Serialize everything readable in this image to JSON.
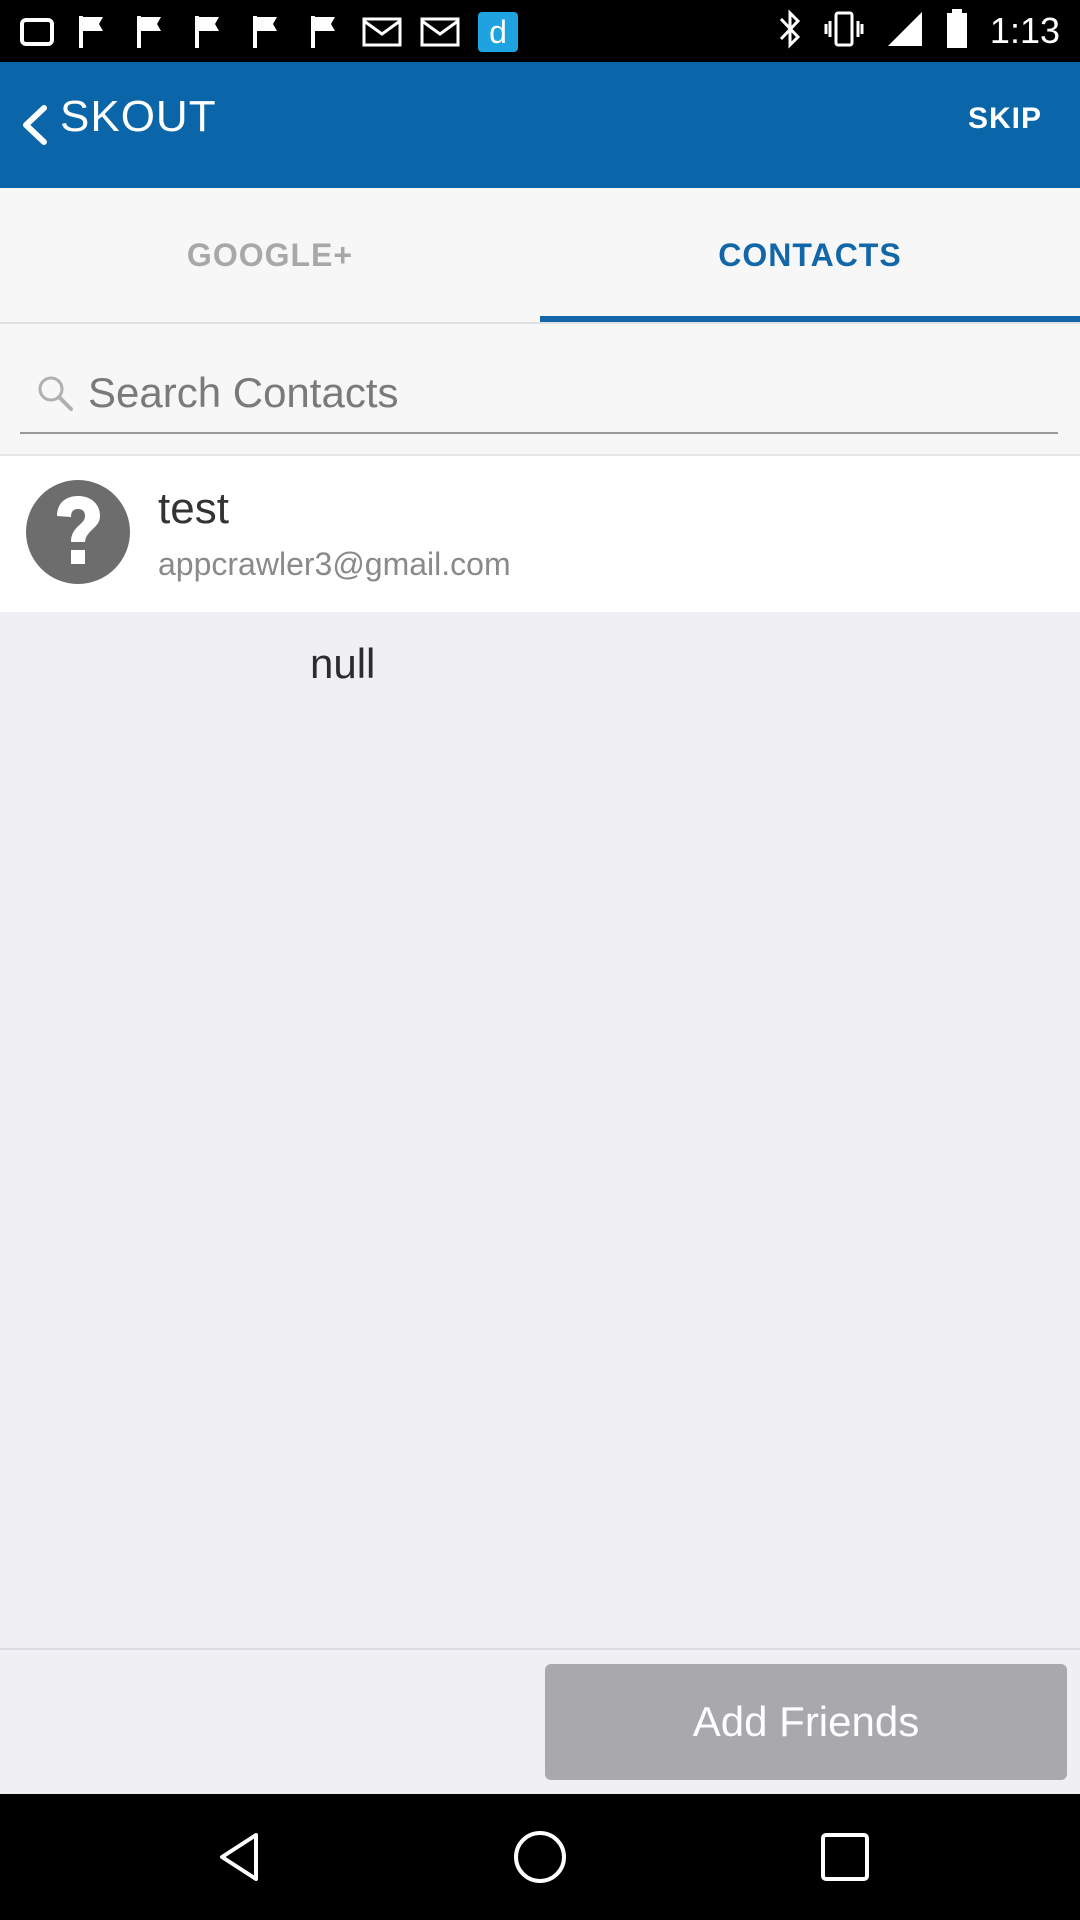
{
  "status_bar": {
    "time": "1:13",
    "icons": [
      "message-icon",
      "flag-icon",
      "flag-icon",
      "flag-icon",
      "flag-icon",
      "flag-icon",
      "email-icon",
      "mail-icon",
      "app-d-icon",
      "bluetooth-icon",
      "vibrate-icon",
      "signal-icon",
      "battery-icon"
    ],
    "app_icon_letter": "d"
  },
  "action_bar": {
    "title": "SKOUT",
    "skip_label": "SKIP",
    "color": "#0a66a8"
  },
  "tabs": {
    "items": [
      {
        "label": "GOOGLE+",
        "selected": false
      },
      {
        "label": "CONTACTS",
        "selected": true
      }
    ],
    "accent": "#1167a8"
  },
  "search": {
    "placeholder": "Search Contacts",
    "value": ""
  },
  "contacts": [
    {
      "name": "test",
      "email": "appcrawler3@gmail.com",
      "avatar_icon": "question-mark-icon"
    }
  ],
  "null_text": "null",
  "add_friends_label": "Add Friends"
}
